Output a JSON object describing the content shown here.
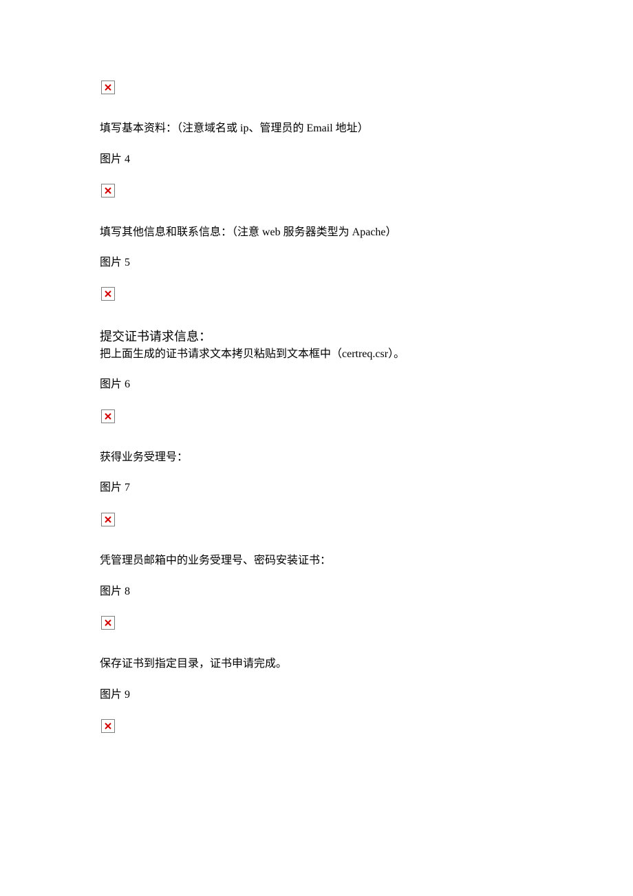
{
  "sections": [
    {
      "type": "image"
    },
    {
      "type": "text",
      "value": "填写基本资料：（注意域名或 ip、管理员的 Email 地址）"
    },
    {
      "type": "caption",
      "prefix": "图片 ",
      "num": "4"
    },
    {
      "type": "image"
    },
    {
      "type": "text",
      "value": "填写其他信息和联系信息：（注意 web 服务器类型为 Apache）"
    },
    {
      "type": "caption",
      "prefix": "图片 ",
      "num": "5"
    },
    {
      "type": "image"
    },
    {
      "type": "heading",
      "value": "提交证书请求信息："
    },
    {
      "type": "text_tight",
      "value": "把上面生成的证书请求文本拷贝粘贴到文本框中（certreq.csr）。"
    },
    {
      "type": "caption",
      "prefix": "图片 ",
      "num": "6"
    },
    {
      "type": "image"
    },
    {
      "type": "text",
      "value": "获得业务受理号："
    },
    {
      "type": "caption",
      "prefix": "图片 ",
      "num": "7"
    },
    {
      "type": "image"
    },
    {
      "type": "text",
      "value": "凭管理员邮箱中的业务受理号、密码安装证书："
    },
    {
      "type": "caption",
      "prefix": "图片 ",
      "num": "8"
    },
    {
      "type": "image"
    },
    {
      "type": "text",
      "value": "保存证书到指定目录，证书申请完成。"
    },
    {
      "type": "caption",
      "prefix": "图片 ",
      "num": "9"
    },
    {
      "type": "image"
    }
  ]
}
